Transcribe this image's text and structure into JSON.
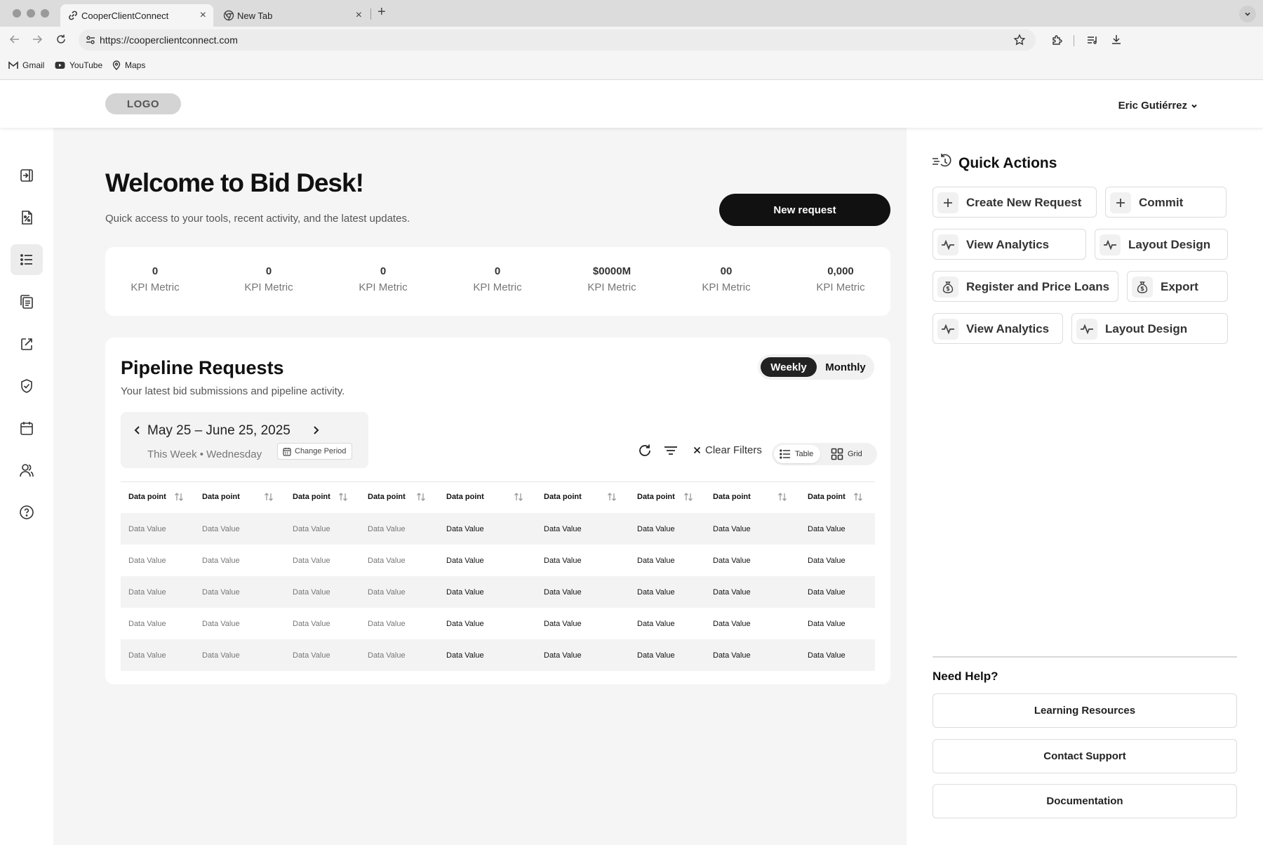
{
  "browser": {
    "tabs": [
      {
        "title": "CooperClientConnect",
        "active": true
      },
      {
        "title": "New Tab",
        "active": false
      }
    ],
    "url": "https://cooperclientconnect.com",
    "bookmarks": [
      {
        "label": "Gmail",
        "icon": "gmail-icon"
      },
      {
        "label": "YouTube",
        "icon": "youtube-icon"
      },
      {
        "label": "Maps",
        "icon": "map-pin-icon"
      }
    ]
  },
  "header": {
    "logo": "LOGO",
    "user_name": "Eric Gutiérrez"
  },
  "sidebar": {
    "items": [
      {
        "icon": "expand-panel-icon",
        "active": false
      },
      {
        "icon": "percent-document-icon",
        "active": false
      },
      {
        "icon": "list-icon",
        "active": true
      },
      {
        "icon": "documents-icon",
        "active": false
      },
      {
        "icon": "share-icon",
        "active": false
      },
      {
        "icon": "shield-check-icon",
        "active": false
      },
      {
        "icon": "calendar-icon",
        "active": false
      },
      {
        "icon": "users-icon",
        "active": false
      },
      {
        "icon": "help-icon",
        "active": false
      }
    ]
  },
  "welcome": {
    "title": "Welcome to Bid Desk!",
    "subtitle": "Quick access to your tools, recent activity, and the latest updates.",
    "new_request_label": "New request"
  },
  "kpis": [
    {
      "value": "0",
      "label": "KPI Metric"
    },
    {
      "value": "0",
      "label": "KPI Metric"
    },
    {
      "value": "0",
      "label": "KPI Metric"
    },
    {
      "value": "0",
      "label": "KPI Metric"
    },
    {
      "value": "$0000M",
      "label": "KPI Metric"
    },
    {
      "value": "00",
      "label": "KPI Metric"
    },
    {
      "value": "0,000",
      "label": "KPI Metric"
    }
  ],
  "pipeline": {
    "title": "Pipeline Requests",
    "subtitle": "Your latest bid submissions and pipeline activity.",
    "period_options": [
      "Weekly",
      "Monthly"
    ],
    "selected_period": "Weekly",
    "date_range": "May 25 – June 25, 2025",
    "date_caption": "This Week • Wednesday",
    "change_period_label": "Change Period",
    "clear_filters_label": "Clear Filters",
    "view_options": [
      "Table",
      "Grid"
    ],
    "selected_view": "Table",
    "columns": [
      "Data point",
      "Data point",
      "Data point",
      "Data point",
      "Data point",
      "Data point",
      "Data point",
      "Data point",
      "Data point"
    ],
    "rows": [
      [
        "Data Value",
        "Data Value",
        "Data Value",
        "Data Value",
        "Data Value",
        "Data Value",
        "Data Value",
        "Data Value",
        "Data Value"
      ],
      [
        "Data Value",
        "Data Value",
        "Data Value",
        "Data Value",
        "Data Value",
        "Data Value",
        "Data Value",
        "Data Value",
        "Data Value"
      ],
      [
        "Data Value",
        "Data Value",
        "Data Value",
        "Data Value",
        "Data Value",
        "Data Value",
        "Data Value",
        "Data Value",
        "Data Value"
      ],
      [
        "Data Value",
        "Data Value",
        "Data Value",
        "Data Value",
        "Data Value",
        "Data Value",
        "Data Value",
        "Data Value",
        "Data Value"
      ],
      [
        "Data Value",
        "Data Value",
        "Data Value",
        "Data Value",
        "Data Value",
        "Data Value",
        "Data Value",
        "Data Value",
        "Data Value"
      ]
    ]
  },
  "quick_actions": {
    "title": "Quick Actions",
    "items": [
      {
        "label": "Create New Request",
        "icon": "plus-icon"
      },
      {
        "label": "Commit",
        "icon": "plus-icon"
      },
      {
        "label": "View Analytics",
        "icon": "activity-icon"
      },
      {
        "label": "Layout Design",
        "icon": "activity-icon"
      },
      {
        "label": "Register and Price Loans",
        "icon": "money-bag-icon"
      },
      {
        "label": "Export",
        "icon": "money-bag-icon"
      },
      {
        "label": "View Analytics",
        "icon": "activity-icon"
      },
      {
        "label": "Layout Design",
        "icon": "activity-icon"
      }
    ]
  },
  "help": {
    "title": "Need Help?",
    "links": [
      "Learning Resources",
      "Contact Support",
      "Documentation"
    ]
  }
}
